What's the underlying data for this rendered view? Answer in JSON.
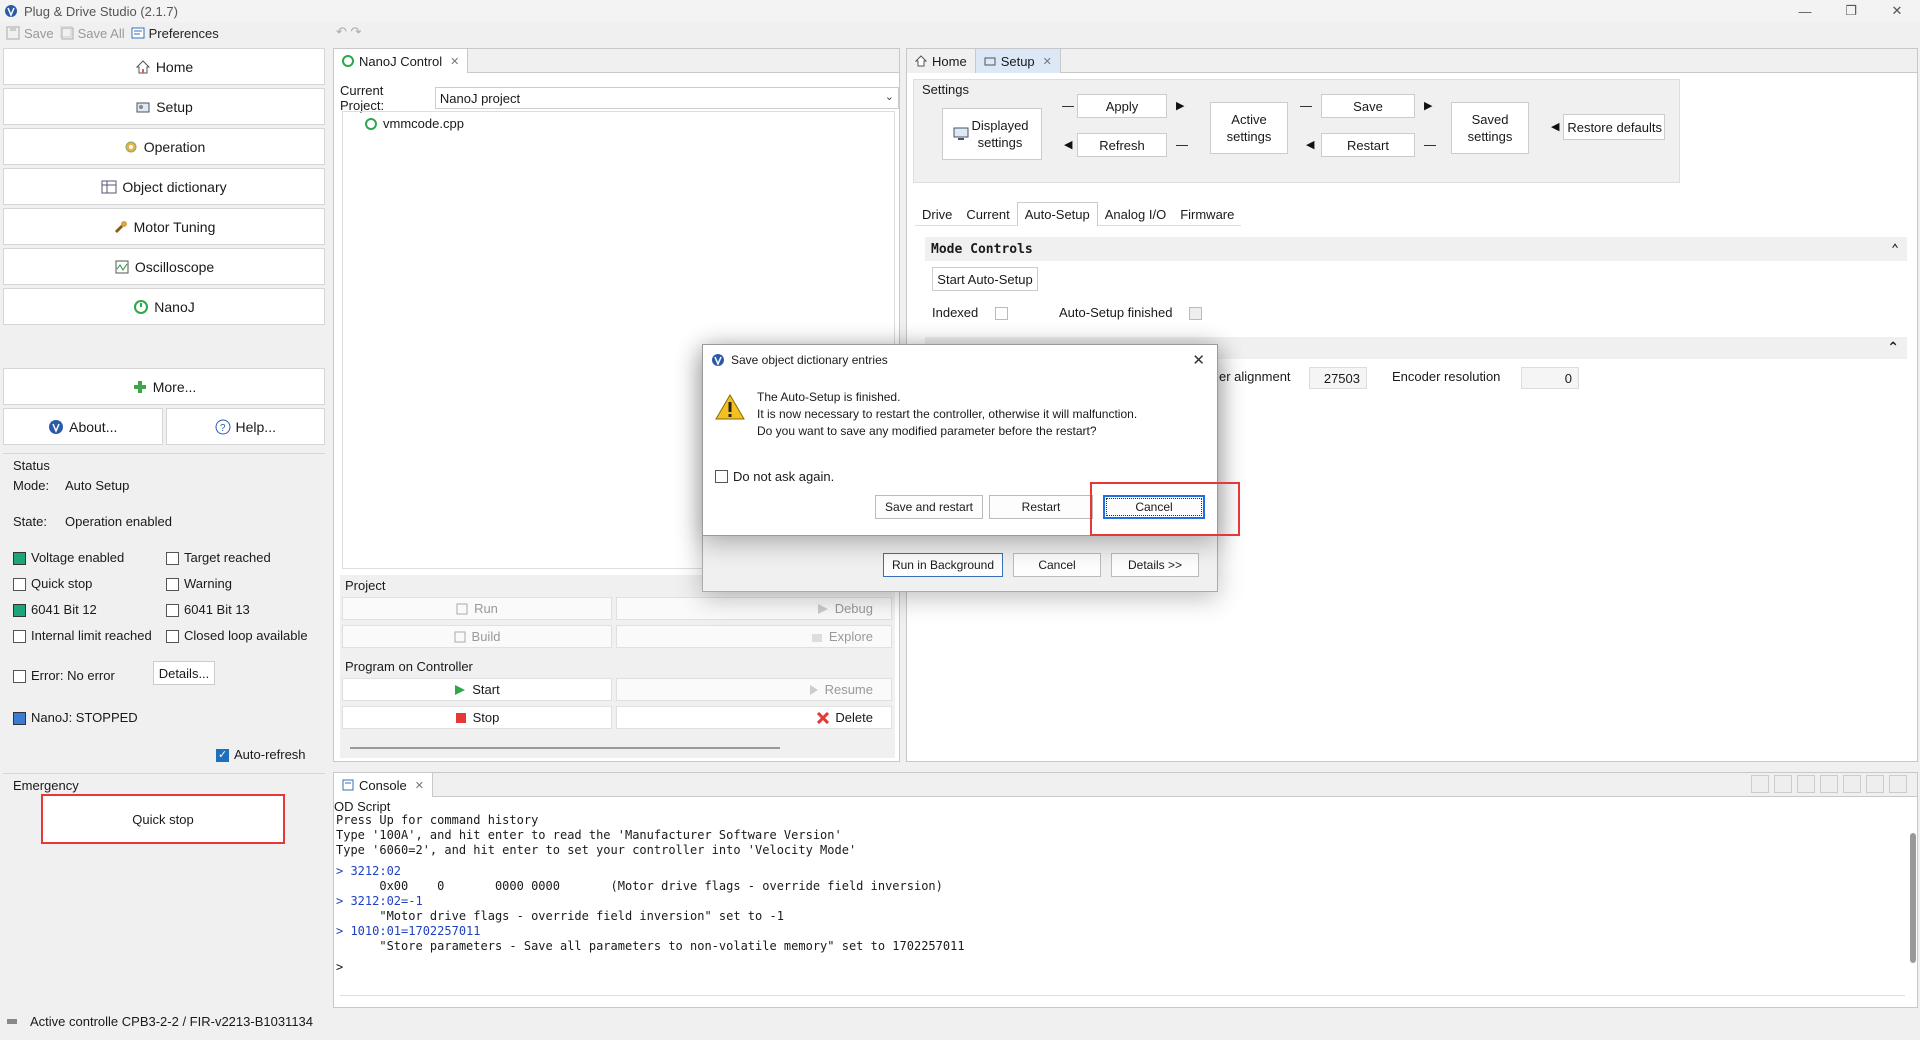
{
  "window": {
    "title": "Plug & Drive Studio (2.1.7)",
    "controls": [
      "—",
      "❐",
      "✕"
    ]
  },
  "toolbar": {
    "save": "Save",
    "save_all": "Save All",
    "preferences": "Preferences"
  },
  "nav": {
    "home": "Home",
    "setup": "Setup",
    "operation": "Operation",
    "object_dictionary": "Object dictionary",
    "motor_tuning": "Motor Tuning",
    "oscilloscope": "Oscilloscope",
    "nanoj": "NanoJ",
    "more": "More...",
    "about": "About...",
    "help": "Help..."
  },
  "status": {
    "title": "Status",
    "mode_label": "Mode:",
    "mode_value": "Auto Setup",
    "state_label": "State:",
    "state_value": "Operation enabled",
    "flags": [
      {
        "label": "Voltage enabled",
        "state": "green"
      },
      {
        "label": "Target reached",
        "state": "off"
      },
      {
        "label": "Quick stop",
        "state": "off"
      },
      {
        "label": "Warning",
        "state": "off"
      },
      {
        "label": "6041 Bit 12",
        "state": "green"
      },
      {
        "label": "6041 Bit 13",
        "state": "off"
      },
      {
        "label": "Internal limit reached",
        "state": "off"
      },
      {
        "label": "Closed loop available",
        "state": "off"
      }
    ],
    "error": "Error:  No error",
    "details": "Details...",
    "nanoj": "NanoJ:  STOPPED",
    "auto_refresh": "Auto-refresh"
  },
  "emergency": {
    "title": "Emergency",
    "quick_stop": "Quick stop"
  },
  "nanoj_panel": {
    "tab": "NanoJ Control",
    "current_project_label": "Current Project:",
    "current_project_value": "NanoJ project",
    "file": "vmmcode.cpp",
    "project_group": "Project",
    "run": "Run",
    "debug": "Debug",
    "build": "Build",
    "explore": "Explore",
    "controller_group": "Program on Controller",
    "start": "Start",
    "resume": "Resume",
    "stop": "Stop",
    "delete": "Delete"
  },
  "setup_panel": {
    "tab_home": "Home",
    "tab_setup": "Setup",
    "settings_title": "Settings",
    "displayed_settings": "Displayed settings",
    "apply": "Apply",
    "refresh": "Refresh",
    "active_settings": "Active settings",
    "save": "Save",
    "restart": "Restart",
    "saved_settings": "Saved settings",
    "restore_defaults": "Restore defaults",
    "subtabs": [
      "Drive",
      "Current",
      "Auto-Setup",
      "Analog I/O",
      "Firmware"
    ],
    "mode_controls": "Mode Controls",
    "start_auto_setup": "Start Auto-Setup",
    "indexed": "Indexed",
    "auto_setup_finished": "Auto-Setup finished",
    "encoder_alignment_label": "er alignment",
    "encoder_alignment_value": "27503",
    "encoder_resolution_label": "Encoder resolution",
    "encoder_resolution_value": "0"
  },
  "console": {
    "tab": "Console",
    "subtitle": "OD Script",
    "lines": [
      {
        "text": "Press Up for command history",
        "cls": ""
      },
      {
        "text": "Type '100A', and hit enter to read the 'Manufacturer Software Version'",
        "cls": ""
      },
      {
        "text": "Type '6060=2', and hit enter to set your controller into 'Velocity Mode'",
        "cls": ""
      },
      {
        "text": "",
        "cls": "gap"
      },
      {
        "text": "> 3212:02",
        "cls": "blue"
      },
      {
        "text": "      0x00    0       0000 0000       (Motor drive flags - override field inversion)",
        "cls": ""
      },
      {
        "text": "> 3212:02=-1",
        "cls": "blue"
      },
      {
        "text": "      \"Motor drive flags - override field inversion\" set to -1",
        "cls": ""
      },
      {
        "text": "> 1010:01=1702257011",
        "cls": "blue"
      },
      {
        "text": "      \"Store parameters - Save all parameters to non-volatile memory\" set to 1702257011",
        "cls": ""
      },
      {
        "text": "",
        "cls": "gap"
      },
      {
        "text": ">",
        "cls": ""
      }
    ]
  },
  "statusbar": {
    "text": "Active controlle   CPB3-2-2 / FIR-v2213-B1031134"
  },
  "dialog": {
    "title": "Save object dictionary entries",
    "line1": "The Auto-Setup is finished.",
    "line2": "It is now necessary to restart the controller, otherwise it will malfunction.",
    "line3": "Do you want to save any modified parameter before the restart?",
    "do_not_ask": "Do not ask again.",
    "save_and_restart": "Save and restart",
    "restart": "Restart",
    "cancel": "Cancel"
  },
  "bg_dialog": {
    "run_in_background": "Run in Background",
    "cancel": "Cancel",
    "details": "Details >>"
  }
}
